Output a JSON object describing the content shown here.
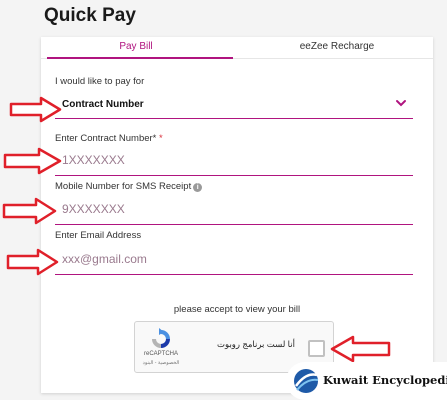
{
  "page": {
    "title": "Quick Pay"
  },
  "tabs": [
    {
      "label": "Pay Bill",
      "active": true
    },
    {
      "label": "eeZee Recharge",
      "active": false
    }
  ],
  "form": {
    "pay_for_label": "I would like to pay for",
    "pay_for_value": "Contract Number",
    "contract_label": "Enter Contract Number*",
    "contract_required_mark": "*",
    "contract_value": "1XXXXXXX",
    "mobile_label": "Mobile Number for SMS Receipt",
    "mobile_value": "9XXXXXXX",
    "email_label": "Enter Email Address",
    "email_placeholder": "xxx@gmail.com"
  },
  "captcha": {
    "accept_text": "please accept to view your bill",
    "checkbox_text": "أنا لست برنامج روبوت",
    "brand": "reCAPTCHA",
    "terms": "الخصوصية - البنود"
  },
  "watermark": {
    "text": "Kuwait Encyclopedia"
  },
  "colors": {
    "accent": "#b0147f",
    "arrow": "#e0202a",
    "required": "#d9303c"
  },
  "icons": [
    "chevron-down-icon",
    "info-icon",
    "recaptcha-logo-icon",
    "arrow-right-icon",
    "arrow-left-icon",
    "globe-logo-icon"
  ]
}
